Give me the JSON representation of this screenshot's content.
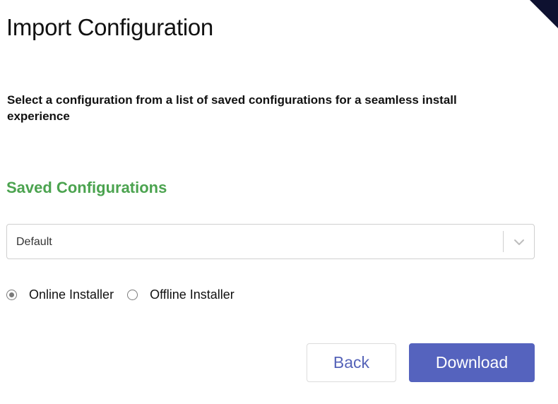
{
  "dialog": {
    "title": "Import Configuration",
    "description": "Select a configuration from a list of saved configurations for a seamless install experience"
  },
  "saved_configurations": {
    "heading": "Saved Configurations",
    "selected_value": "Default"
  },
  "installer_type": {
    "selected": "online",
    "options": [
      {
        "label": "Online Installer",
        "checked": true
      },
      {
        "label": "Offline Installer",
        "checked": false
      }
    ]
  },
  "actions": {
    "back_label": "Back",
    "download_label": "Download"
  },
  "colors": {
    "heading_green": "#4ba34f",
    "primary_button": "#5563be",
    "back_text": "#5563b8",
    "corner_mark": "#0e1130"
  },
  "icons": {
    "select": "chevron-down-icon",
    "corner": "corner-triangle-icon"
  }
}
